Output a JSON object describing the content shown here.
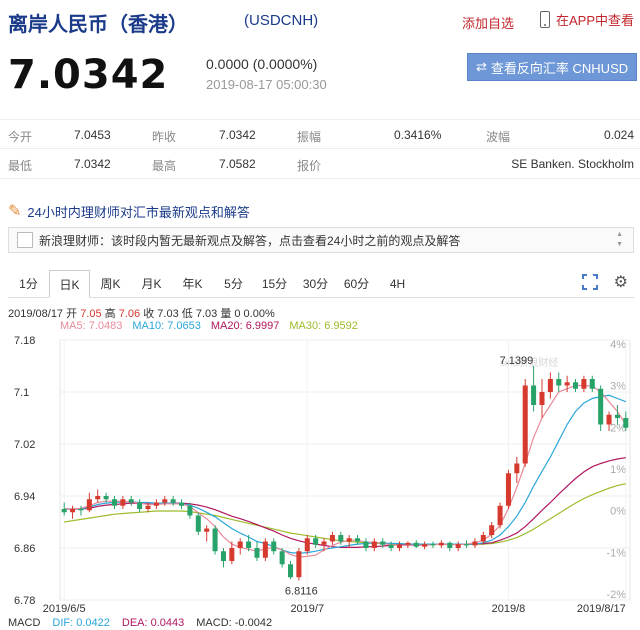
{
  "header": {
    "title": "离岸人民币（香港）",
    "code": "(USDCNH)",
    "add_favorite": "添加自选",
    "app_link": "在APP中查看"
  },
  "summary": {
    "price": "7.0342",
    "change": "0.0000 (0.0000%)",
    "timestamp": "2019-08-17 05:00:30",
    "reverse_button": "查看反向汇率 CNHUSD"
  },
  "quote_table": {
    "row1": [
      {
        "label": "今开",
        "value": "7.0453"
      },
      {
        "label": "昨收",
        "value": "7.0342"
      },
      {
        "label": "振幅",
        "value": "0.3416%"
      },
      {
        "label": "波幅",
        "value": "0.024"
      }
    ],
    "row2": [
      {
        "label": "最低",
        "value": "7.0342"
      },
      {
        "label": "最高",
        "value": "7.0582"
      },
      {
        "label": "报价",
        "value": "SE Banken. Stockholm"
      }
    ]
  },
  "news_bar": "24小时内理财师对汇市最新观点和解答",
  "notice": "新浪理财师：该时段内暂无最新观点及解答，点击查看24小时之前的观点及解答",
  "tabs": [
    "1分",
    "日K",
    "周K",
    "月K",
    "年K",
    "5分",
    "15分",
    "30分",
    "60分",
    "4H"
  ],
  "active_tab": "日K",
  "ohlc_info": {
    "date": "2019/08/17",
    "open_label": "开",
    "open": "7.05",
    "high_label": "高",
    "high": "7.06",
    "close_label": "收",
    "close": "7.03",
    "low_label": "低",
    "low": "7.03",
    "vol_label": "量",
    "vol": "0 0.00%"
  },
  "ma_legend": [
    {
      "text": "MA5: 7.0483",
      "color": "#e88a9a"
    },
    {
      "text": "MA10: 7.0653",
      "color": "#2aa6d9"
    },
    {
      "text": "MA20: 6.9997",
      "color": "#b0175f"
    },
    {
      "text": "MA30: 6.9592",
      "color": "#9bbb2a"
    }
  ],
  "macd": [
    {
      "text": "MACD",
      "color": "#333333"
    },
    {
      "text": "DIF: 0.0422",
      "color": "#2aa6d9"
    },
    {
      "text": "DEA: 0.0443",
      "color": "#b0175f"
    },
    {
      "text": "MACD: -0.0042",
      "color": "#333333"
    }
  ],
  "chart_data": {
    "type": "candlestick",
    "y_ticks": [
      "7.18",
      "7.1",
      "7.02",
      "6.94",
      "6.86",
      "6.78"
    ],
    "y_pct_ticks": [
      "4%",
      "3%",
      "2%",
      "1%",
      "0%",
      "-1%",
      "-2%"
    ],
    "x_ticks": [
      "2019/6/5",
      "2019/7",
      "2019/8",
      "2019/8/17"
    ],
    "ylim": [
      6.78,
      7.18
    ],
    "annotations": {
      "max": "7.1399",
      "min": "6.8116"
    },
    "watermark": "sina新浪财经",
    "colors": {
      "up": "#d63a2f",
      "down": "#27a36a",
      "ma5": "#e88a9a",
      "ma10": "#2aa6d9",
      "ma20": "#b0175f",
      "ma30": "#9bbb2a"
    },
    "candles": [
      [
        6.92,
        6.93,
        6.91,
        6.915
      ],
      [
        6.915,
        6.925,
        6.905,
        6.92
      ],
      [
        6.92,
        6.925,
        6.91,
        6.918
      ],
      [
        6.918,
        6.945,
        6.915,
        6.935
      ],
      [
        6.935,
        6.95,
        6.93,
        6.94
      ],
      [
        6.94,
        6.945,
        6.93,
        6.935
      ],
      [
        6.935,
        6.94,
        6.92,
        6.925
      ],
      [
        6.925,
        6.94,
        6.92,
        6.935
      ],
      [
        6.935,
        6.94,
        6.925,
        6.93
      ],
      [
        6.93,
        6.935,
        6.915,
        6.92
      ],
      [
        6.92,
        6.93,
        6.915,
        6.925
      ],
      [
        6.925,
        6.935,
        6.92,
        6.93
      ],
      [
        6.93,
        6.94,
        6.925,
        6.935
      ],
      [
        6.935,
        6.94,
        6.925,
        6.93
      ],
      [
        6.93,
        6.935,
        6.92,
        6.925
      ],
      [
        6.925,
        6.93,
        6.905,
        6.91
      ],
      [
        6.91,
        6.915,
        6.88,
        6.885
      ],
      [
        6.885,
        6.895,
        6.87,
        6.89
      ],
      [
        6.89,
        6.895,
        6.85,
        6.855
      ],
      [
        6.855,
        6.86,
        6.83,
        6.84
      ],
      [
        6.84,
        6.87,
        6.835,
        6.86
      ],
      [
        6.86,
        6.875,
        6.85,
        6.87
      ],
      [
        6.87,
        6.88,
        6.855,
        6.86
      ],
      [
        6.86,
        6.87,
        6.84,
        6.845
      ],
      [
        6.845,
        6.875,
        6.84,
        6.87
      ],
      [
        6.87,
        6.875,
        6.85,
        6.855
      ],
      [
        6.855,
        6.86,
        6.83,
        6.835
      ],
      [
        6.835,
        6.84,
        6.812,
        6.815
      ],
      [
        6.815,
        6.86,
        6.81,
        6.855
      ],
      [
        6.855,
        6.88,
        6.85,
        6.875
      ],
      [
        6.875,
        6.88,
        6.86,
        6.865
      ],
      [
        6.865,
        6.875,
        6.855,
        6.87
      ],
      [
        6.87,
        6.885,
        6.865,
        6.88
      ],
      [
        6.88,
        6.885,
        6.865,
        6.87
      ],
      [
        6.87,
        6.88,
        6.86,
        6.875
      ],
      [
        6.875,
        6.88,
        6.865,
        6.87
      ],
      [
        6.87,
        6.875,
        6.855,
        6.86
      ],
      [
        6.86,
        6.875,
        6.855,
        6.87
      ],
      [
        6.87,
        6.875,
        6.86,
        6.865
      ],
      [
        6.865,
        6.87,
        6.855,
        6.86
      ],
      [
        6.86,
        6.87,
        6.855,
        6.865
      ],
      [
        6.865,
        6.87,
        6.86,
        6.868
      ],
      [
        6.868,
        6.872,
        6.86,
        6.862
      ],
      [
        6.862,
        6.87,
        6.858,
        6.866
      ],
      [
        6.866,
        6.87,
        6.86,
        6.864
      ],
      [
        6.864,
        6.872,
        6.86,
        6.868
      ],
      [
        6.868,
        6.87,
        6.855,
        6.86
      ],
      [
        6.86,
        6.87,
        6.855,
        6.866
      ],
      [
        6.866,
        6.872,
        6.86,
        6.864
      ],
      [
        6.864,
        6.875,
        6.86,
        6.87
      ],
      [
        6.87,
        6.885,
        6.865,
        6.88
      ],
      [
        6.88,
        6.9,
        6.875,
        6.895
      ],
      [
        6.895,
        6.93,
        6.89,
        6.925
      ],
      [
        6.925,
        6.98,
        6.92,
        6.975
      ],
      [
        6.975,
        7.0,
        6.96,
        6.99
      ],
      [
        6.99,
        7.12,
        6.985,
        7.11
      ],
      [
        7.11,
        7.14,
        7.07,
        7.08
      ],
      [
        7.08,
        7.12,
        7.06,
        7.1
      ],
      [
        7.1,
        7.13,
        7.09,
        7.12
      ],
      [
        7.12,
        7.13,
        7.1,
        7.11
      ],
      [
        7.11,
        7.125,
        7.1,
        7.115
      ],
      [
        7.115,
        7.12,
        7.1,
        7.105
      ],
      [
        7.105,
        7.125,
        7.1,
        7.12
      ],
      [
        7.12,
        7.125,
        7.1,
        7.105
      ],
      [
        7.105,
        7.11,
        7.04,
        7.05
      ],
      [
        7.05,
        7.07,
        7.04,
        7.065
      ],
      [
        7.065,
        7.08,
        7.05,
        7.06
      ],
      [
        7.06,
        7.07,
        7.04,
        7.045
      ]
    ],
    "ma5": [
      6.92,
      6.92,
      6.921,
      6.925,
      6.93,
      6.932,
      6.932,
      6.932,
      6.931,
      6.929,
      6.927,
      6.927,
      6.928,
      6.928,
      6.928,
      6.924,
      6.914,
      6.905,
      6.893,
      6.877,
      6.866,
      6.861,
      6.858,
      6.855,
      6.859,
      6.861,
      6.857,
      6.85,
      6.846,
      6.847,
      6.849,
      6.857,
      6.864,
      6.869,
      6.872,
      6.872,
      6.869,
      6.869,
      6.867,
      6.865,
      6.864,
      6.864,
      6.864,
      6.864,
      6.865,
      6.866,
      6.865,
      6.865,
      6.866,
      6.868,
      6.872,
      6.881,
      6.895,
      6.921,
      6.953,
      6.99,
      7.03,
      7.06,
      7.08,
      7.1,
      7.105,
      7.11,
      7.11,
      7.109,
      7.1,
      7.085,
      7.07,
      7.05
    ],
    "ma10": [
      6.92,
      6.92,
      6.92,
      6.923,
      6.927,
      6.929,
      6.93,
      6.931,
      6.931,
      6.93,
      6.93,
      6.929,
      6.929,
      6.929,
      6.928,
      6.926,
      6.921,
      6.915,
      6.908,
      6.899,
      6.89,
      6.883,
      6.877,
      6.87,
      6.867,
      6.862,
      6.857,
      6.853,
      6.852,
      6.853,
      6.855,
      6.858,
      6.86,
      6.862,
      6.864,
      6.866,
      6.867,
      6.868,
      6.868,
      6.867,
      6.867,
      6.866,
      6.866,
      6.866,
      6.866,
      6.866,
      6.866,
      6.866,
      6.866,
      6.866,
      6.868,
      6.872,
      6.88,
      6.893,
      6.909,
      6.93,
      6.955,
      6.978,
      7.0,
      7.025,
      7.05,
      7.07,
      7.083,
      7.09,
      7.093,
      7.095,
      7.09,
      7.085
    ],
    "ma20": [
      6.92,
      6.92,
      6.92,
      6.921,
      6.924,
      6.926,
      6.927,
      6.928,
      6.929,
      6.929,
      6.929,
      6.929,
      6.929,
      6.929,
      6.929,
      6.928,
      6.926,
      6.923,
      6.919,
      6.914,
      6.909,
      6.905,
      6.901,
      6.896,
      6.891,
      6.886,
      6.88,
      6.875,
      6.871,
      6.868,
      6.866,
      6.864,
      6.862,
      6.861,
      6.861,
      6.861,
      6.862,
      6.862,
      6.863,
      6.864,
      6.865,
      6.866,
      6.866,
      6.866,
      6.866,
      6.866,
      6.866,
      6.866,
      6.866,
      6.866,
      6.867,
      6.868,
      6.872,
      6.877,
      6.883,
      6.893,
      6.905,
      6.918,
      6.93,
      6.943,
      6.955,
      6.967,
      6.977,
      6.985,
      6.99,
      6.994,
      6.997,
      6.999
    ],
    "ma30": [
      6.9,
      6.902,
      6.904,
      6.906,
      6.908,
      6.91,
      6.912,
      6.913,
      6.914,
      6.915,
      6.916,
      6.917,
      6.917,
      6.917,
      6.917,
      6.916,
      6.914,
      6.912,
      6.91,
      6.907,
      6.904,
      6.901,
      6.898,
      6.895,
      6.892,
      6.889,
      6.886,
      6.883,
      6.881,
      6.879,
      6.877,
      6.875,
      6.873,
      6.871,
      6.87,
      6.869,
      6.868,
      6.867,
      6.867,
      6.866,
      6.866,
      6.866,
      6.866,
      6.866,
      6.866,
      6.866,
      6.866,
      6.866,
      6.866,
      6.866,
      6.866,
      6.867,
      6.869,
      6.872,
      6.876,
      6.882,
      6.889,
      6.897,
      6.905,
      6.913,
      6.921,
      6.929,
      6.936,
      6.942,
      6.947,
      6.952,
      6.956,
      6.959
    ]
  }
}
